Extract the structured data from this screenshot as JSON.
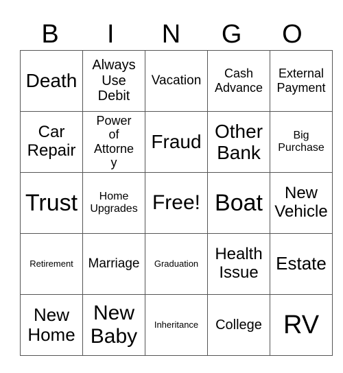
{
  "header": {
    "letters": [
      "B",
      "I",
      "N",
      "G",
      "O"
    ]
  },
  "card": {
    "rows": [
      [
        "Death",
        "Always Use Debit",
        "Vacation",
        "Cash Advance",
        "External Payment"
      ],
      [
        "Car Repair",
        "Power of Attorney",
        "Fraud",
        "Other Bank",
        "Big Purchase"
      ],
      [
        "Trust",
        "Home Upgrades",
        "Free!",
        "Boat",
        "New Vehicle"
      ],
      [
        "Retirement",
        "Marriage",
        "Graduation",
        "Health Issue",
        "Estate"
      ],
      [
        "New Home",
        "New Baby",
        "Inheritance",
        "College",
        "RV"
      ]
    ]
  }
}
